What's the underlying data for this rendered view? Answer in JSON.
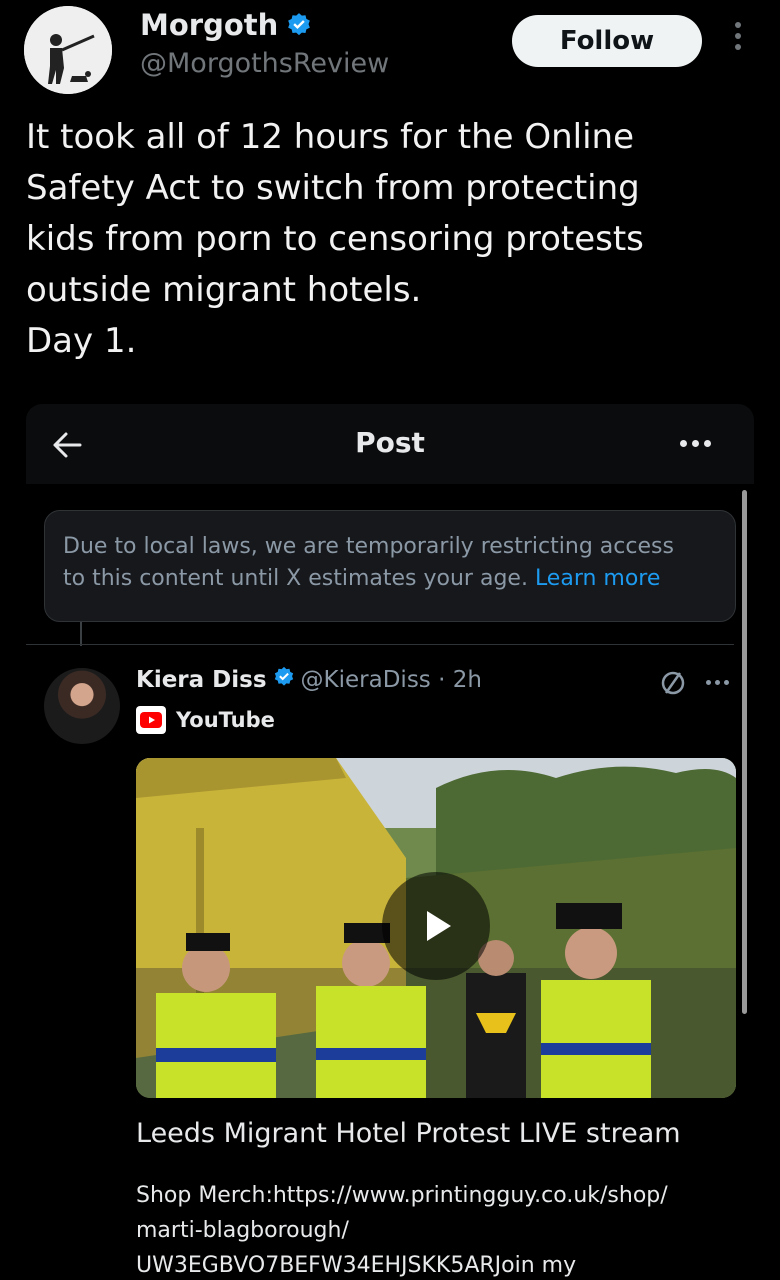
{
  "author": {
    "name": "Morgoth",
    "handle": "@MorgothsReview",
    "avatar_icon": "avatar-silhouette-icon"
  },
  "actions": {
    "follow_label": "Follow"
  },
  "tweet": {
    "text": "It took all of 12 hours for the Online\nSafety Act to switch from protecting\nkids from porn to censoring protests\noutside migrant hotels.\nDay 1."
  },
  "embedded_post": {
    "header_title": "Post",
    "restriction_text": "Due to local laws, we are temporarily restricting access\nto this content until X estimates your age.",
    "learn_more_label": "Learn more",
    "quoted": {
      "name": "Kiera Diss",
      "handle_time": "@KieraDiss · 2h",
      "source_label": "YouTube",
      "video_title": "Leeds Migrant Hotel Protest LIVE stream",
      "video_description": "Shop Merch:https://www.printingguy.co.uk/shop/\nmarti-blagborough/\nUW3EGBVO7BEFW34EHJSKK5ARJoin my"
    }
  },
  "colors": {
    "background": "#000000",
    "text": "#e7e9ea",
    "secondary_text": "#71767b",
    "accent": "#1d9bf0",
    "verified": "#1d9bf0"
  }
}
